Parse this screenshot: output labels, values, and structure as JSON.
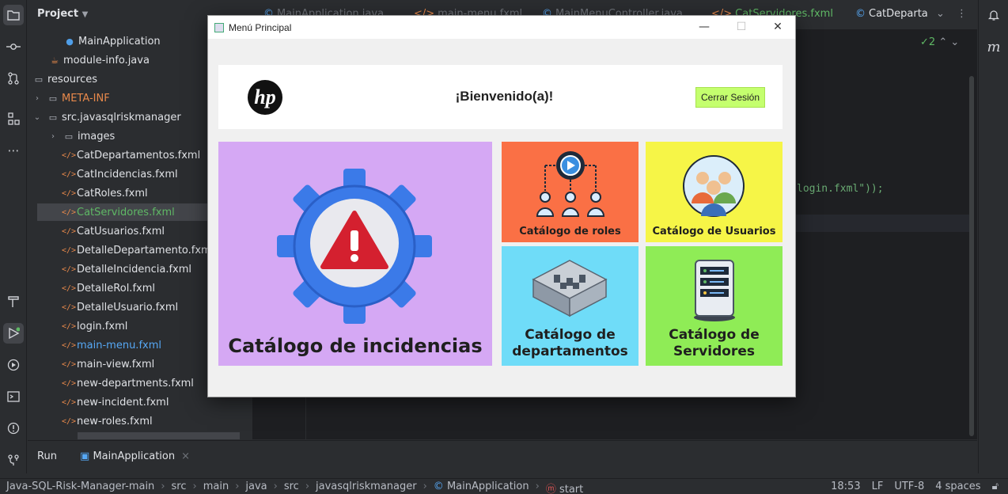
{
  "ide": {
    "project_header": "Project",
    "tree": [
      {
        "label": "MainApplication",
        "icon": "java-class-icon"
      },
      {
        "label": "module-info.java",
        "icon": "java-file-icon"
      },
      {
        "label": "resources",
        "icon": "folder-icon"
      },
      {
        "label": "META-INF",
        "icon": "folder-icon"
      },
      {
        "label": "src.javasqlriskmanager",
        "icon": "folder-icon"
      },
      {
        "label": "images",
        "icon": "folder-icon"
      },
      {
        "label": "CatDepartamentos.fxml",
        "icon": "fxml-icon"
      },
      {
        "label": "CatIncidencias.fxml",
        "icon": "fxml-icon"
      },
      {
        "label": "CatRoles.fxml",
        "icon": "fxml-icon"
      },
      {
        "label": "CatServidores.fxml",
        "icon": "fxml-icon"
      },
      {
        "label": "CatUsuarios.fxml",
        "icon": "fxml-icon"
      },
      {
        "label": "DetalleDepartamento.fxml",
        "icon": "fxml-icon"
      },
      {
        "label": "DetalleIncidencia.fxml",
        "icon": "fxml-icon"
      },
      {
        "label": "DetalleRol.fxml",
        "icon": "fxml-icon"
      },
      {
        "label": "DetalleUsuario.fxml",
        "icon": "fxml-icon"
      },
      {
        "label": "login.fxml",
        "icon": "fxml-icon"
      },
      {
        "label": "main-menu.fxml",
        "icon": "fxml-icon"
      },
      {
        "label": "main-view.fxml",
        "icon": "fxml-icon"
      },
      {
        "label": "new-departments.fxml",
        "icon": "fxml-icon"
      },
      {
        "label": "new-incident.fxml",
        "icon": "fxml-icon"
      },
      {
        "label": "new-roles.fxml",
        "icon": "fxml-icon"
      }
    ],
    "tabs": [
      "MainApplication.java",
      "main-menu.fxml",
      "MainMenuController.java",
      "CatServidores.fxml",
      "CatDeparta"
    ],
    "code_fragment": "login.fxml\"));",
    "inspection_count": "2",
    "right_strip_label": "m",
    "run_label": "Run",
    "run_tab": "MainApplication",
    "breadcrumbs": [
      "Java-SQL-Risk-Manager-main",
      "src",
      "main",
      "java",
      "src",
      "javasqlriskmanager",
      "MainApplication",
      "start"
    ],
    "status": {
      "time": "18:53",
      "line_sep": "LF",
      "encoding": "UTF-8",
      "indent": "4 spaces"
    }
  },
  "app": {
    "title": "Menú Principal",
    "logo": "hp",
    "welcome": "¡Bienvenido(a)!",
    "logout": "Cerrar Sesión",
    "tiles": {
      "incidents": "Catálogo de incidencias",
      "roles": "Catálogo de roles",
      "users": "Catálogo de Usuarios",
      "departments_1": "Catálogo de",
      "departments_2": "departamentos",
      "servers_1": "Catálogo de",
      "servers_2": "Servidores"
    }
  }
}
